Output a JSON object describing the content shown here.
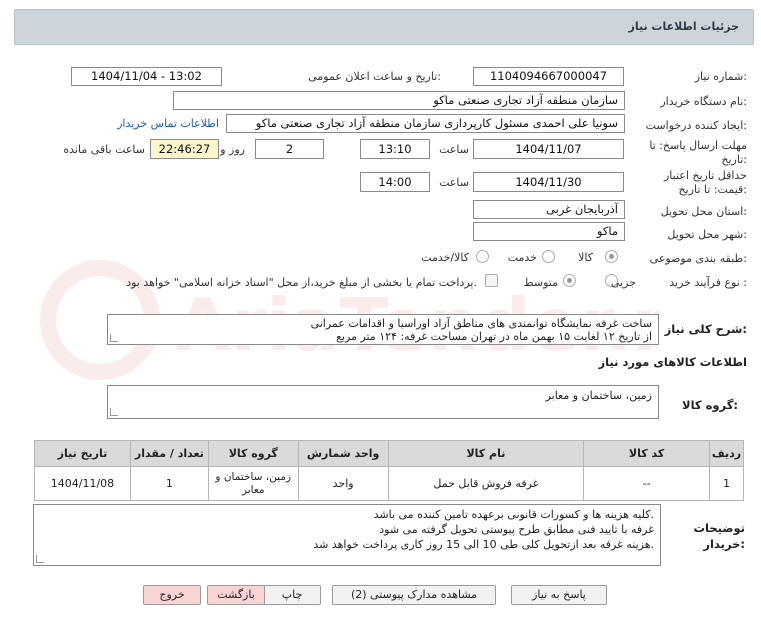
{
  "header": {
    "title": "جزئیات اطلاعات نیاز"
  },
  "fields": {
    "need_number_label": "شماره نیاز:",
    "need_number": "1104094667000047",
    "announce_label": "تاریخ و ساعت اعلان عمومی:",
    "announce_value": "1404/11/04 - 13:02",
    "buyer_org_label": "نام دستگاه خریدار:",
    "buyer_org": "سازمان منطقه آزاد تجاری   صنعتی ماکو",
    "requester_label": "ایجاد کننده درخواست:",
    "requester": "سونیا علی احمدی مسئول کارپردازی سازمان منطقه آزاد تجاری   صنعتی ماکو",
    "contact_link": "اطلاعات تماس خریدار",
    "deadline_label_1": "مهلت ارسال پاسخ: تا",
    "deadline_label_2": "تاریخ:",
    "deadline_date": "1404/11/07",
    "time_label": "ساعت",
    "deadline_time": "13:10",
    "days_value": "2",
    "days_label": "روز و",
    "remaining_time": "22:46:27",
    "remaining_label": "ساعت باقی مانده",
    "validity_label_1": "حداقل تاریخ اعتبار",
    "validity_label_2": "قیمت: تا تاریخ:",
    "validity_date": "1404/11/30",
    "validity_time": "14:00",
    "province_label": "استان محل تحویل:",
    "province": "آذربایجان غربی",
    "city_label": "شهر محل تحویل:",
    "city": "ماکو",
    "category_label": "طبقه بندی موضوعی:",
    "category_options": [
      "کالا",
      "خدمت",
      "کالا/خدمت"
    ],
    "purchase_type_label": "نوع فرآیند خرید :",
    "purchase_options": [
      "جزیی",
      "متوسط"
    ],
    "payment_note": "پرداخت تمام یا بخشی از مبلغ خرید،از محل \"اسناد خزانه اسلامی\" خواهد بود."
  },
  "description": {
    "label": "شرح کلی نیاز:",
    "line1": "ساخت غرفه نمایشگاه توانمندی های مناطق آزاد اوراسیا و اقدامات عمرانی",
    "line2": "از تاریخ ۱۲ لغایت ۱۵ بهمن ماه در تهران مساحت غرفه: ۱۲۴ متر مربع"
  },
  "goods_section": {
    "title": "اطلاعات کالاهای مورد نیاز",
    "group_label": "گروه کالا:",
    "group_value": "زمین، ساختمان و معابر"
  },
  "table": {
    "headers": [
      "ردیف",
      "کد کالا",
      "نام کالا",
      "واحد شمارش",
      "گروه کالا",
      "تعداد / مقدار",
      "تاریخ نیاز"
    ],
    "rows": [
      [
        "1",
        "--",
        "غرفه فروش قابل حمل",
        "واحد",
        "زمین، ساختمان و معابر",
        "1",
        "1404/11/08"
      ]
    ]
  },
  "buyer_notes": {
    "label_1": "توضیحات",
    "label_2": "خریدار:",
    "line1": "کلیه هزینه ها و کسورات قانونی برعهده تامین کننده می باشد.",
    "line2": "غرفه با تایید فنی مطابق طرح  پیوستی تحویل گرفته می شود",
    "line3": "هزینه غرفه بعد ازتحویل کلی طی 10 الی 15 روز کاری پرداخت خواهد شد."
  },
  "buttons": {
    "reply": "پاسخ به نیاز",
    "docs": "مشاهده مدارک پیوستی (2)",
    "print": "چاپ",
    "back": "بازگشت",
    "exit": "خروج"
  },
  "watermark": "AriaTender.net"
}
